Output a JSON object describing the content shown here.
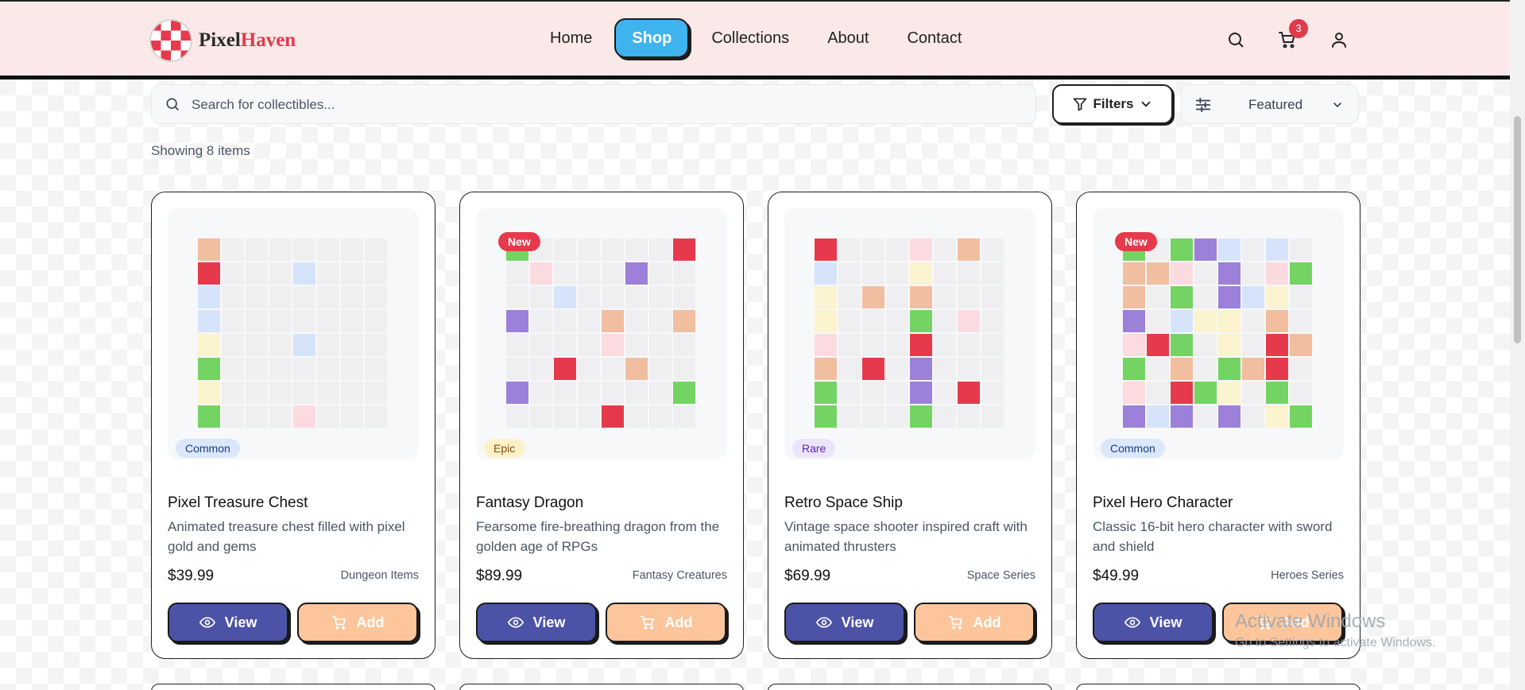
{
  "brand": {
    "name_primary": "Pixel",
    "name_accent": "Haven"
  },
  "nav": [
    {
      "label": "Home",
      "active": false
    },
    {
      "label": "Shop",
      "active": true
    },
    {
      "label": "Collections",
      "active": false
    },
    {
      "label": "About",
      "active": false
    },
    {
      "label": "Contact",
      "active": false
    }
  ],
  "header_actions": {
    "search_icon": "search-icon",
    "cart_icon": "cart-icon",
    "cart_count": "3",
    "user_icon": "user-icon"
  },
  "search": {
    "placeholder": "Search for collectibles..."
  },
  "filters": {
    "label": "Filters"
  },
  "sort": {
    "selected": "Featured"
  },
  "results": {
    "count_text": "Showing 8 items"
  },
  "colors": {
    "accent_red": "#e63a4c",
    "shop_blue": "#3fb3ee",
    "view_button": "#4c53a7",
    "add_button": "#fcc59b",
    "header_bg": "#fbe9ea"
  },
  "palette": {
    "o": "#f2bea0",
    "r": "#e63a4c",
    "b": "#d6e4fb",
    "y": "#fcf3cf",
    "g": "#74d463",
    "p": "#fcdbe0",
    "v": "#9c80d9",
    ".": "#efeff1"
  },
  "products": [
    {
      "title": "Pixel Treasure Chest",
      "description": "Animated treasure chest filled with pixel gold and gems",
      "price": "$39.99",
      "series": "Dungeon Items",
      "rarity": "Common",
      "rarity_class": "common",
      "is_new": false,
      "view_label": "View",
      "add_label": "Add",
      "pixels": [
        "o.......",
        "r...b...",
        "b.......",
        "b.......",
        "y...b...",
        "g.......",
        "y.......",
        "g...p..."
      ]
    },
    {
      "title": "Fantasy Dragon",
      "description": "Fearsome fire-breathing dragon from the golden age of RPGs",
      "price": "$89.99",
      "series": "Fantasy Creatures",
      "rarity": "Epic",
      "rarity_class": "epic",
      "is_new": true,
      "new_label": "New",
      "view_label": "View",
      "add_label": "Add",
      "pixels": [
        "g......r.",
        ".p...v...",
        "..b......",
        "v...o..o.",
        "....p....",
        "..r..o...",
        "v......g.",
        "....r...v"
      ]
    },
    {
      "title": "Retro Space Ship",
      "description": "Vintage space shooter inspired craft with animated thrusters",
      "price": "$69.99",
      "series": "Space Series",
      "rarity": "Rare",
      "rarity_class": "rare",
      "is_new": false,
      "view_label": "View",
      "add_label": "Add",
      "pixels": [
        "r...p.o.",
        "b...y...",
        "y.o.o...",
        "y...g.p.",
        "p...r...",
        "o.r.v...",
        "g...v.r.",
        "g...g..."
      ]
    },
    {
      "title": "Pixel Hero Character",
      "description": "Classic 16-bit hero character with sword and shield",
      "price": "$49.99",
      "series": "Heroes Series",
      "rarity": "Common",
      "rarity_class": "common",
      "is_new": true,
      "new_label": "New",
      "view_label": "View",
      "add_label": "Add",
      "pixels": [
        "g.gvb.b.",
        "oop.v.pg",
        "o.g.vby.",
        "v.byy.o.",
        "prg.y.ro",
        "g.o.gor.",
        "p.rgy.g.",
        "vbv.v.yg"
      ]
    }
  ],
  "watermark": {
    "line1": "Activate Windows",
    "line2": "Go to Settings to activate Windows."
  }
}
